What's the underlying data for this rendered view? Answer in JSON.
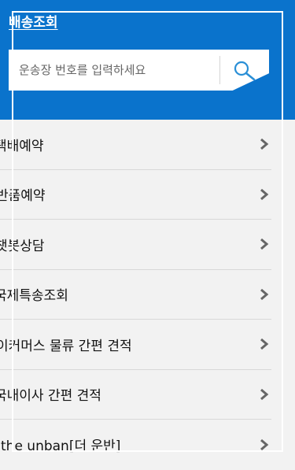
{
  "header": {
    "title": "배송조회",
    "search_placeholder": "운송장 번호를 입력하세요",
    "search_icon": "search-icon",
    "background": "#0a73cc"
  },
  "menu": {
    "items": [
      {
        "label": "택배예약",
        "icon": "chevron-right-icon"
      },
      {
        "label": "반품예약",
        "icon": "chevron-right-icon"
      },
      {
        "label": "챗봇상담",
        "icon": "chevron-right-icon"
      },
      {
        "label": "국제특송조회",
        "icon": "chevron-right-icon"
      },
      {
        "label": "이커머스 물류 간편 견적",
        "icon": "chevron-right-icon"
      },
      {
        "label": "국내이사 간편 견적",
        "icon": "chevron-right-icon"
      },
      {
        "label": "the unban[더 운반]",
        "icon": "chevron-right-icon"
      }
    ]
  }
}
